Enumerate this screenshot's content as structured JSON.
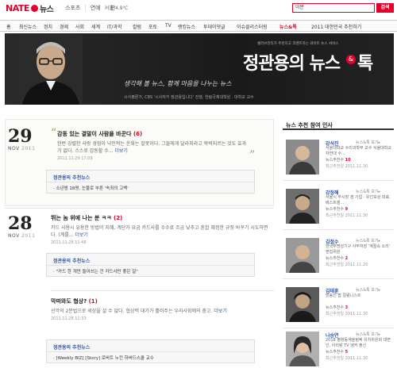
{
  "top": {
    "logo_nate": "NATE",
    "logo_news": "뉴스",
    "nav": [
      "스포츠",
      "연예",
      "판"
    ],
    "weather": "서울 4.9℃",
    "search_value": "이분",
    "search_button": "검색"
  },
  "gnb": {
    "items": [
      "홈",
      "최신뉴스",
      "정치",
      "경제",
      "사회",
      "세계",
      "IT/과학",
      "칼럼",
      "포토",
      "TV",
      "랭킹뉴스",
      "투데이댓글",
      "이슈클리스터링",
      "뉴스&톡"
    ],
    "active_index": 13,
    "year_label": "2011 대한민국 추천하기"
  },
  "banner": {
    "small_text": "셀러브리티가 추천하고 코멘트하는 네이트 뉴스 서비스",
    "title": "정관용의 뉴스",
    "amp": "&",
    "tok": "톡",
    "slogan": "생각해 볼 뉴스, 함께 마음을 나누는 뉴스",
    "credit": "시사평론가, CBS '시사자키 정관용입니다' 진행, 한림국제대학원 · 대학교 교수"
  },
  "days": [
    {
      "num": "29",
      "mon": "NOV",
      "yr": "2011",
      "headline": "감동 있는 결말이 사람을 바꾼다",
      "count": "(6)",
      "body": "한번 강렬한 사랑 경험이 낙인적는 운화는 잘못이다. 그들에게 달라지라고 묵박지르는 것도 효과가 없다. 스스로 갑동할 수...",
      "more": "더보기",
      "ts": "2011.11.29 17:09",
      "rec_title": "정관용의 추천뉴스",
      "rec_item": "· 소년범 18명, 눈물로 부른 '속죄의 고백'"
    },
    {
      "num": "28",
      "mon": "NOV",
      "yr": "2011",
      "headline": "뛰는 놈 위에 나는 분 ㅋㅋ",
      "count": "(2)",
      "body": "카드 사용시 유용한 방법이 지혜, 계단가 요금 카드사를 수수료 조금 낮추고 혼합 혜정한 규정 바꾸기 시도하면다. (계를...",
      "more": "더보기",
      "ts": "2011.11.28 11:48",
      "rec_title": "정관용의 추천뉴스",
      "rec_item": "· \"카드 한 개만 들어쓰는 건 카드사만 좋은 일\""
    },
    {
      "num": "",
      "mon": "",
      "yr": "",
      "headline": "막떠와도 협상?",
      "count": "(1)",
      "body": "선악의 2분법으로 세상을 살 수 없다. 협상력 대가가 흘러주는 우리사회에의 충고.",
      "more": "더보기",
      "ts": "2011.11.28 11:33",
      "rec_title": "정관용의 추천뉴스",
      "rec_item": "· [Weekly BIZ] [Story] 로버트 누킨 하버드스쿨 교수"
    }
  ],
  "side": {
    "title": "뉴스 추천 참여 인사",
    "people": [
      {
        "name": "강석진",
        "view": "뉴스&톡 보기▸",
        "desc": "서울대학교 수리과학부 교수 서울대학교 자연대 수...",
        "cnt_label": "뉴스추천수",
        "cnt": "10",
        "date": "최근추천일 2011.11.30"
      },
      {
        "name": "강정해",
        "view": "뉴스&톡 보기▸",
        "desc": "서울시 부시장 겸 기업 · 유인보상 대표, 베스트셀...",
        "cnt_label": "뉴스추천수",
        "cnt": "9",
        "date": "최근추천일 2011.11.30"
      },
      {
        "name": "김정수",
        "view": "뉴스&톡 보기▸",
        "desc": "한국투명성기구 사무처장 '계절속 소리' 편집위원",
        "cnt_label": "뉴스추천수",
        "cnt": "2",
        "date": "최근추천일 2011.11.29"
      },
      {
        "name": "김태훈",
        "view": "뉴스&톡 보기▸",
        "desc": "방송인 팝 칼럼니스트",
        "cnt_label": "뉴스추천수",
        "cnt": "3",
        "date": "최근추천일 2011.11.30"
      },
      {
        "name": "나승연",
        "view": "뉴스&톡 보기▸",
        "desc": "2018 평창동계올림픽 유치위원회 대변인, 아리랑 TV 앵커 출신",
        "cnt_label": "뉴스추천수",
        "cnt": "5",
        "date": "최근추천일 2011.11.30"
      }
    ]
  },
  "colors": {
    "accent": "#e4002b",
    "link": "#2d56a8"
  }
}
